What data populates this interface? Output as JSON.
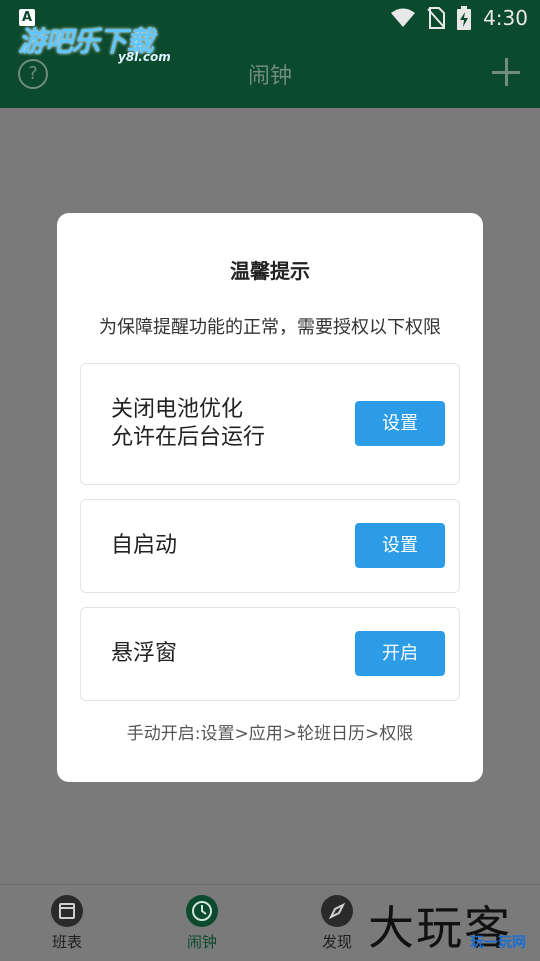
{
  "status_bar": {
    "time": "4:30",
    "a_label": "A"
  },
  "app_bar": {
    "title": "闹钟",
    "help_label": "?"
  },
  "watermark_top": {
    "text": "游吧乐下载",
    "sub": "y8l.com"
  },
  "dialog": {
    "title": "温馨提示",
    "message": "为保障提醒功能的正常，需要授权以下权限",
    "items": [
      {
        "line1": "关闭电池优化",
        "line2": "允许在后台运行",
        "button": "设置"
      },
      {
        "line1": "自启动",
        "button": "设置"
      },
      {
        "line1": "悬浮窗",
        "button": "开启"
      }
    ],
    "footer": "手动开启:设置>应用>轮班日历>权限"
  },
  "bottom_nav": {
    "items": [
      {
        "label": "班表",
        "icon": "calendar-icon"
      },
      {
        "label": "闹钟",
        "icon": "clock-icon",
        "active": true
      },
      {
        "label": "发现",
        "icon": "compass-icon"
      }
    ]
  },
  "watermark_bottom": {
    "text": "大玩客",
    "sub": "玩一玩网"
  }
}
